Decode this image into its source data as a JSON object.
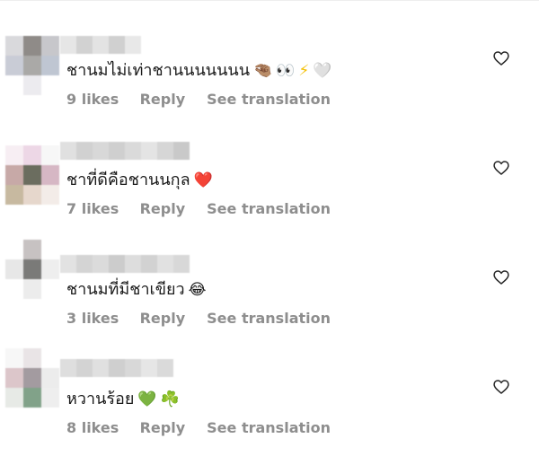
{
  "comments": [
    {
      "text": "ชานมไม่เท่าชานนนนนนน",
      "emojis": [
        "🤏🏽",
        "👀",
        "⚡",
        "🤍"
      ],
      "likes_label": "9 likes",
      "reply_label": "Reply",
      "translate_label": "See translation",
      "avatar_colors": [
        "#d9d9dc",
        "#8f8b88",
        "#c7c7cb",
        "#c9ccd6",
        "#aaa9a7",
        "#bfc6d2",
        "#ffffff",
        "#ecebef",
        "#ffffff"
      ],
      "username_colors": [
        "#e6e6e6",
        "#d2d2d2",
        "#e3e3e3",
        "#d0d0d0",
        "#e8e8e8"
      ]
    },
    {
      "text": "ชาที่ดีคือชานนกุล",
      "emojis": [
        "❤️"
      ],
      "likes_label": "7 likes",
      "reply_label": "Reply",
      "translate_label": "See translation",
      "avatar_colors": [
        "#f7eef3",
        "#edd7e6",
        "#f7f7f7",
        "#c7a9a7",
        "#6b6d5f",
        "#d6b7c4",
        "#c7b9a0",
        "#e6d7cc",
        "#f3ece8"
      ],
      "username_colors": [
        "#e0e0e0",
        "#d1d1d1",
        "#d8d8d8",
        "#cfcfcf",
        "#dadada",
        "#e4e4e4",
        "#d6d6d6",
        "#c9c9c9"
      ]
    },
    {
      "text": "ชานมที่มีชาเขียว",
      "emojis": [
        "😂"
      ],
      "likes_label": "3 likes",
      "reply_label": "Reply",
      "translate_label": "See translation",
      "avatar_colors": [
        "#ffffff",
        "#c7c2c2",
        "#ffffff",
        "#e7e7e7",
        "#7a7a78",
        "#eeeeee",
        "#ffffff",
        "#ececec",
        "#ffffff"
      ],
      "username_colors": [
        "#e2e2e2",
        "#d4d4d4",
        "#dbdbdb",
        "#cccccc",
        "#dddddd",
        "#d2d2d2",
        "#e1e1e1",
        "#d8d8d8"
      ]
    },
    {
      "text": "หวานร้อย",
      "emojis": [
        "💚",
        "☘️"
      ],
      "likes_label": "8 likes",
      "reply_label": "Reply",
      "translate_label": "See translation",
      "avatar_colors": [
        "#f7f7f7",
        "#e9e4e6",
        "#ffffff",
        "#dcc6ca",
        "#a39ba0",
        "#ececec",
        "#e7eae6",
        "#81a289",
        "#eeeeee"
      ],
      "username_colors": [
        "#dedede",
        "#d3d3d3",
        "#e0e0e0",
        "#cfcfcf",
        "#d8d8d8",
        "#e6e6e6",
        "#dadada"
      ]
    }
  ]
}
